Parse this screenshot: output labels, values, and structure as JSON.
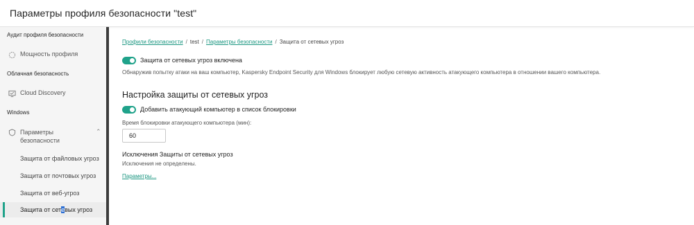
{
  "header": {
    "title": "Параметры профиля безопасности \"test\""
  },
  "sidebar": {
    "sections": [
      {
        "label": "Аудит профиля безопасности"
      },
      {
        "label": "Облачная безопасность"
      },
      {
        "label": "Windows"
      }
    ],
    "items": [
      {
        "label": "Мощность профиля",
        "icon": "gauge-icon"
      },
      {
        "label": "Cloud Discovery",
        "icon": "monitor-icon"
      },
      {
        "label_line1": "Параметры",
        "label_line2": "безопасности",
        "icon": "shield-icon"
      }
    ],
    "subitems": [
      {
        "label": "Защита от файловых угроз"
      },
      {
        "label": "Защита от почтовых угроз"
      },
      {
        "label": "Защита от веб-угроз"
      },
      {
        "label_pre": "Защита от сет",
        "label_sel": "е",
        "label_post": "вых угроз"
      }
    ],
    "chevron": "⌃",
    "active_color": "#1fa28a"
  },
  "main": {
    "breadcrumb": {
      "link1": "Профили безопасности",
      "sep": "/",
      "plain": "test",
      "link2": "Параметры безопасности",
      "current": "Защита от сетевых угроз"
    },
    "toggle1": {
      "label": "Защита от сетевых угроз включена",
      "on": true
    },
    "description": "Обнаружив попытку атаки на ваш компьютер, Kaspersky Endpoint Security для Windows блокирует любую сетевую активность атакующего компьютера в отношении вашего компьютера.",
    "section_title": "Настройка защиты от сетевых угроз",
    "toggle2": {
      "label": "Добавить атакующий компьютер в список блокировки",
      "on": true
    },
    "block_time": {
      "label": "Время блокировки атакующего компьютера (мин):",
      "value": "60"
    },
    "exclusions": {
      "title": "Исключения Защиты от сетевых угроз",
      "text": "Исключения не определены.",
      "link": "Параметры..."
    }
  }
}
